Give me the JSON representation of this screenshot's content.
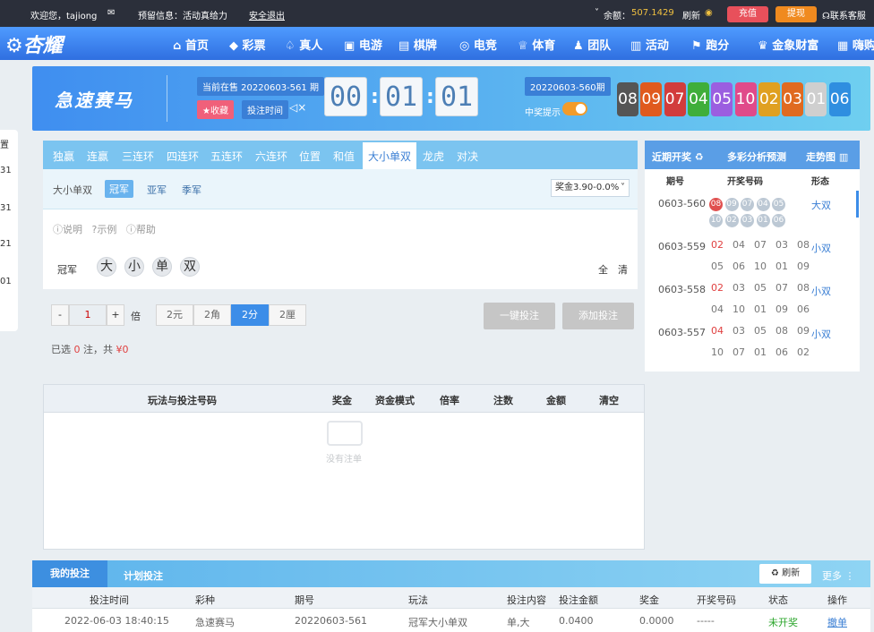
{
  "topbar": {
    "welcome": "欢迎您，tajiong",
    "notice_label": "预留信息：活动真给力",
    "logout": "安全退出",
    "balance_label": "余额：",
    "balance_value": "507.1429",
    "refresh": "刷新",
    "deposit": "充值",
    "withdraw": "提现",
    "support": "联系客服"
  },
  "nav": {
    "logo": "杏耀",
    "items": [
      "首页",
      "彩票",
      "真人",
      "电游",
      "棋牌",
      "电竞",
      "体育",
      "团队",
      "活动",
      "跑分",
      "金象财富",
      "嗨购"
    ]
  },
  "header": {
    "game_name": "急速赛马",
    "current_period": "当前在售 20220603-561 期",
    "collect": "★收藏",
    "bet_time": "投注时间",
    "countdown": [
      "00",
      "01",
      "01"
    ],
    "last_period": "20220603-560期",
    "win_tip": "中奖提示",
    "results": [
      "08",
      "09",
      "07",
      "04",
      "05",
      "10",
      "02",
      "03",
      "01",
      "06"
    ]
  },
  "tabs": [
    "独赢",
    "连赢",
    "三连环",
    "四连环",
    "五连环",
    "六连环",
    "位置",
    "和值",
    "大小单双",
    "龙虎",
    "对决"
  ],
  "subtabs": {
    "group": "大小单双",
    "items": [
      "冠军",
      "亚军",
      "季军"
    ],
    "odds": "奖金3.90-0.0%"
  },
  "info": [
    "说明",
    "示例",
    "帮助"
  ],
  "pick": {
    "label": "冠军",
    "options": [
      "大",
      "小",
      "单",
      "双"
    ],
    "all": "全",
    "clear": "清"
  },
  "controls": {
    "multiplier": "1",
    "multiple_label": "倍",
    "minus": "-",
    "plus": "+",
    "units": [
      "2元",
      "2角",
      "2分",
      "2厘"
    ],
    "quick_bet": "一键投注",
    "add_bet": "添加投注",
    "summary_prefix": "已选",
    "summary_count": "0",
    "summary_mid": "注，共",
    "summary_amount": "¥0"
  },
  "recent": {
    "tabs": [
      "近期开奖",
      "多彩分析预测",
      "走势图"
    ],
    "cols": [
      "期号",
      "开奖号码",
      "形态"
    ],
    "rows": [
      {
        "period": "0603-560",
        "nums": [
          "08",
          "09",
          "07",
          "04",
          "05",
          "10",
          "02",
          "03",
          "01",
          "06"
        ],
        "form": "大双"
      },
      {
        "period": "0603-559",
        "nums": [
          "02",
          "04",
          "07",
          "03",
          "08",
          "05",
          "06",
          "10",
          "01",
          "09"
        ],
        "form": "小双"
      },
      {
        "period": "0603-558",
        "nums": [
          "02",
          "03",
          "05",
          "07",
          "08",
          "04",
          "10",
          "01",
          "09",
          "06"
        ],
        "form": "小双"
      },
      {
        "period": "0603-557",
        "nums": [
          "04",
          "03",
          "05",
          "08",
          "09",
          "10",
          "07",
          "01",
          "06",
          "02"
        ],
        "form": "小双"
      }
    ]
  },
  "betlist": {
    "cols": [
      "玩法与投注号码",
      "奖金",
      "资金模式",
      "倍率",
      "注数",
      "金额",
      "清空"
    ],
    "empty": "没有注单"
  },
  "mybets": {
    "tabs": [
      "我的投注",
      "计划投注"
    ],
    "refresh": "刷新",
    "more": "更多",
    "cols": [
      "投注时间",
      "彩种",
      "期号",
      "玩法",
      "投注内容",
      "投注金额",
      "奖金",
      "开奖号码",
      "状态",
      "操作"
    ],
    "row": [
      "2022-06-03 18:40:15",
      "急速赛马",
      "20220603-561",
      "冠军大小单双",
      "单,大",
      "0.0400",
      "0.0000",
      "-----",
      "未开奖",
      "撤单"
    ]
  },
  "sidebar": {
    "title": "置",
    "items": [
      "31",
      "31",
      "21",
      "01"
    ]
  },
  "colors": {
    "balls": [
      "#555555",
      "#e05a1e",
      "#d23c3c",
      "#3fae3a",
      "#9b5ee0",
      "#e04a8a",
      "#e0a020",
      "#e06a20",
      "#e0e0e0",
      "#2f8ee0"
    ]
  }
}
